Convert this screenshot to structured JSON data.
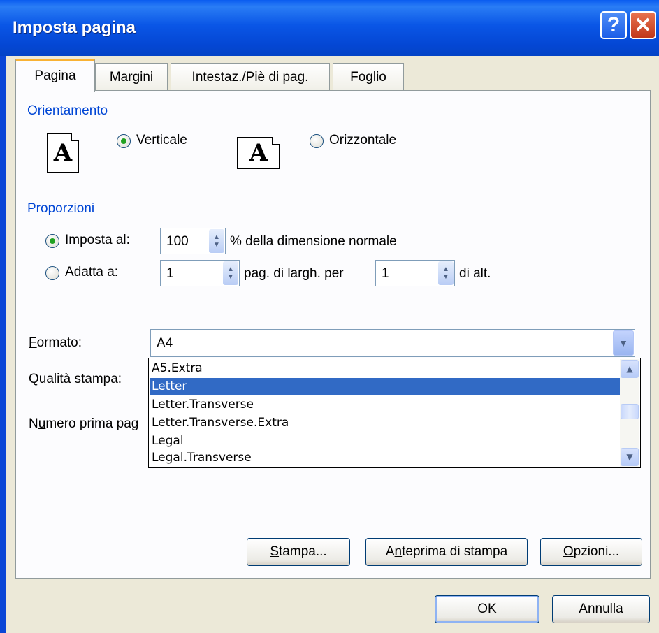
{
  "window": {
    "title": "Imposta pagina",
    "help_icon": "?",
    "close_icon": "✕"
  },
  "tabs": [
    {
      "label": "Pagina",
      "active": true
    },
    {
      "label": "Margini"
    },
    {
      "label": "Intestaz./Piè di pag."
    },
    {
      "label": "Foglio"
    }
  ],
  "orientation": {
    "group_title": "Orientamento",
    "portrait": {
      "label_pre": "",
      "label_u": "V",
      "label_post": "erticale",
      "checked": true,
      "icon_letter": "A"
    },
    "landscape": {
      "label_pre": "Ori",
      "label_u": "z",
      "label_post": "zontale",
      "checked": false,
      "icon_letter": "A"
    }
  },
  "scaling": {
    "group_title": "Proporzioni",
    "set_to": {
      "label_pre": "",
      "label_u": "I",
      "label_post": "mposta al:",
      "value": "100",
      "suffix": "% della dimensione normale",
      "checked": true
    },
    "fit_to": {
      "label_pre": "A",
      "label_u": "d",
      "label_post": "atta a:",
      "wide_value": "1",
      "wide_suffix": "pag. di largh. per",
      "tall_value": "1",
      "tall_suffix": "di alt.",
      "checked": false
    }
  },
  "paper": {
    "format_label_u": "F",
    "format_label_post": "ormato:",
    "format_value": "A4",
    "quality_label": "Qualità stampa:",
    "first_page_label_pre": "N",
    "first_page_label_u": "u",
    "first_page_label_post": "mero prima pag",
    "options": [
      "A5.Extra",
      "Letter",
      "Letter.Transverse",
      "Letter.Transverse.Extra",
      "Legal",
      "Legal.Transverse"
    ],
    "selected_index": 1
  },
  "buttons": {
    "print": {
      "u": "S",
      "post": "tampa..."
    },
    "preview": {
      "pre": "A",
      "u": "n",
      "post": "teprima di stampa"
    },
    "options": {
      "u": "O",
      "post": "pzioni..."
    },
    "ok": "OK",
    "cancel": "Annulla"
  },
  "colors": {
    "titlebar": "#0a56e6",
    "accent": "#0046d5",
    "selection": "#316ac5",
    "radio_dot": "#21a121"
  }
}
